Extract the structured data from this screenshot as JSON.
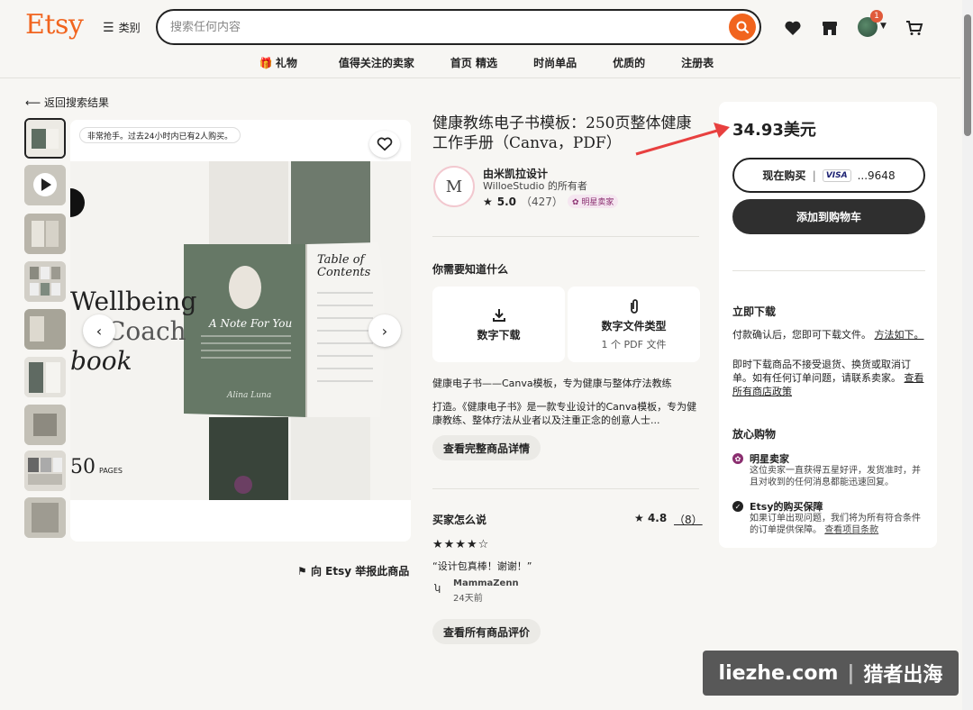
{
  "header": {
    "logo": "Etsy",
    "categories_label": "类别",
    "search_placeholder": "搜索任何内容",
    "cart_badge": "1"
  },
  "nav": [
    "礼物",
    "值得关注的卖家",
    "首页 精选",
    "时尚单品",
    "优质的",
    "注册表"
  ],
  "back_label": "返回搜索结果",
  "gallery": {
    "pill": "非常抢手。过去24小时内已有2人购买。",
    "cover_text": [
      "Wellbeing",
      "Coach",
      "book"
    ],
    "page_count": "50",
    "pages_label": "PAGES",
    "book_left_title": "A Note For You",
    "book_right_title": "Table of Contents",
    "book_signature": "Alina Luna"
  },
  "report_label": "向 Etsy 举报此商品",
  "product": {
    "title": "健康教练电子书模板：250页整体健康工作手册（Canva，PDF）",
    "shop_logo_letter": "M",
    "shop_name": "由米凯拉设计",
    "shop_owner": "WilloeStudio 的所有者",
    "rating": "5.0",
    "reviews": "（427）",
    "star_seller": "明星卖家"
  },
  "know": {
    "heading": "你需要知道什么",
    "card1_title": "数字下载",
    "card2_title": "数字文件类型",
    "card2_sub": "1 个 PDF 文件"
  },
  "description": {
    "line1": "健康电子书——Canva模板，专为健康与整体疗法教练",
    "para": "打造。《健康电子书》是一款专业设计的Canva模板，专为健康教练、整体疗法从业者以及注重正念的创意人士...",
    "more_button": "查看完整商品详情"
  },
  "reviews": {
    "heading": "买家怎么说",
    "avg": "4.8",
    "count": "（8）",
    "stars": "★★★★☆",
    "quote": "“设计包真棒！谢谢！”",
    "reviewer": "MammaZenn",
    "date": "24天前",
    "all_button": "查看所有商品评价"
  },
  "purchase": {
    "price": "34.93美元",
    "buy_now": "现在购买",
    "card_brand": "VISA",
    "card_last4": "...9648",
    "add_to_cart": "添加到购物车"
  },
  "info": {
    "instant_heading": "立即下载",
    "instant_text": "付款确认后，您即可下载文件。",
    "instant_link": "方法如下。",
    "policy_text": "即时下载商品不接受退货、换货或取消订单。如有任何订单问题，请联系卖家。",
    "policy_link": "查看所有商店政策",
    "secure_heading": "放心购物",
    "star_title": "明星卖家",
    "star_text": "这位卖家一直获得五星好评，发货准时，并且对收到的任何消息都能迅速回复。",
    "protect_title": "Etsy的购买保障",
    "protect_text": "如果订单出现问题，我们将为所有符合条件的订单提供保障。",
    "protect_link": "查看项目条款"
  },
  "watermark": {
    "left": "liezhe.com",
    "right": "猎者出海"
  },
  "colors": {
    "brand": "#f1641e",
    "dark_button": "#2f2f2f",
    "annotation_arrow": "#e8403f"
  }
}
